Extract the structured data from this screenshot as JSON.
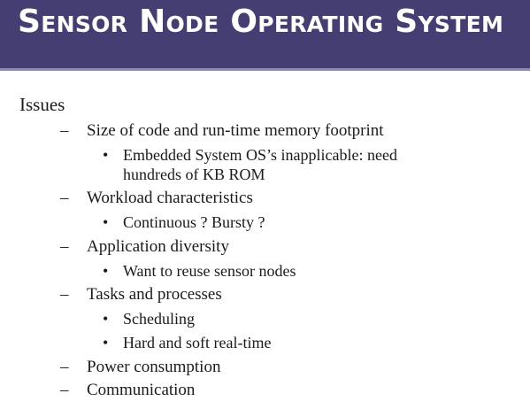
{
  "slide": {
    "title": "Sensor Node Operating System",
    "heading": "Issues",
    "dash_marker": "–",
    "bullet_marker": "•",
    "items": [
      {
        "label": "Size of code and run-time memory footprint",
        "subitems": [
          "Embedded System OS’s inapplicable: need",
          "hundreds of KB ROM"
        ]
      },
      {
        "label": "Workload characteristics",
        "subitems": [
          "Continuous ? Bursty ?"
        ]
      },
      {
        "label": "Application diversity",
        "subitems": [
          "Want to reuse sensor nodes"
        ]
      },
      {
        "label": "Tasks and processes",
        "subitems": [
          "Scheduling",
          "Hard and soft real-time"
        ]
      },
      {
        "label": "Power consumption",
        "subitems": []
      },
      {
        "label": "Communication",
        "subitems": []
      }
    ]
  },
  "colors": {
    "title_bar": "#453e73",
    "title_text": "#ffffff",
    "body_text": "#1a1a1a"
  }
}
